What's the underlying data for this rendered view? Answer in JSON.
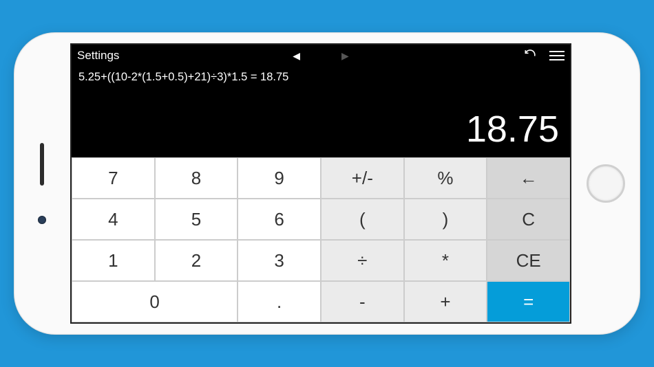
{
  "titlebar": {
    "settings_label": "Settings"
  },
  "display": {
    "expression": "5.25+((10-2*(1.5+0.5)+21)÷3)*1.5 = 18.75",
    "result": "18.75"
  },
  "keys": {
    "k7": "7",
    "k8": "8",
    "k9": "9",
    "plusminus": "+/-",
    "percent": "%",
    "back": "←",
    "k4": "4",
    "k5": "5",
    "k6": "6",
    "lparen": "(",
    "rparen": ")",
    "clear": "C",
    "k1": "1",
    "k2": "2",
    "k3": "3",
    "divide": "÷",
    "multiply": "*",
    "ce": "CE",
    "k0": "0",
    "dot": ".",
    "minus": "-",
    "plus": "+",
    "equals": "="
  }
}
